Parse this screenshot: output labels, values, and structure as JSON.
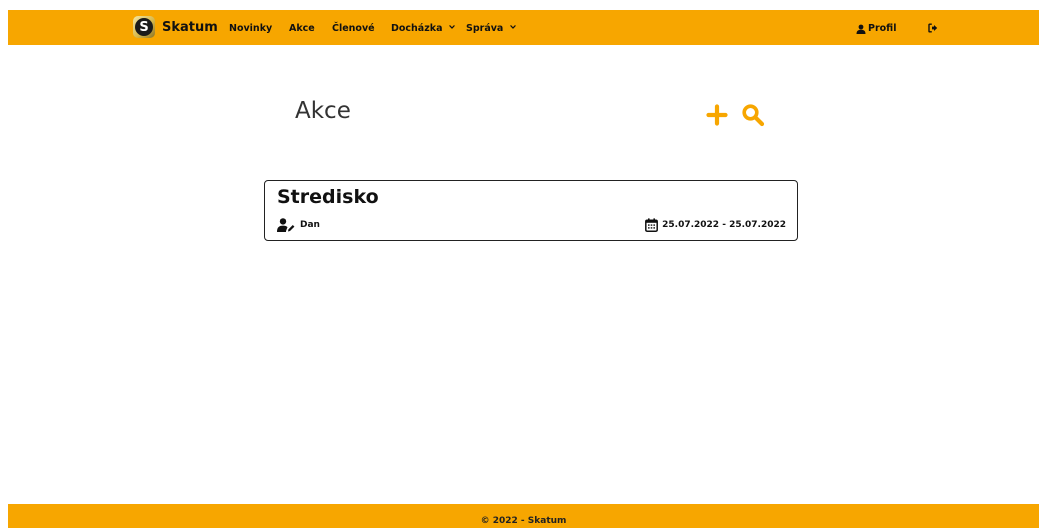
{
  "brand": {
    "logo_letter": "S",
    "name": "Skatum"
  },
  "nav": {
    "items": [
      {
        "label": "Novinky"
      },
      {
        "label": "Akce"
      },
      {
        "label": "Členové"
      },
      {
        "label": "Docházka",
        "dropdown": true
      },
      {
        "label": "Správa",
        "dropdown": true
      }
    ],
    "profile_label": "Profil",
    "profile_icon": "user-icon",
    "logout_icon": "sign-out-icon"
  },
  "page": {
    "title": "Akce",
    "add_icon": "plus-icon",
    "search_icon": "search-icon"
  },
  "events": [
    {
      "title": "Stredisko",
      "author": "Dan",
      "author_icon": "user-pen-icon",
      "date_range": "25.07.2022 - 25.07.2022",
      "date_icon": "calendar-icon"
    }
  ],
  "footer": {
    "text": "© 2022 - Skatum"
  },
  "colors": {
    "accent": "#f7a600",
    "text": "#111111",
    "action_icon": "#f7a600"
  }
}
